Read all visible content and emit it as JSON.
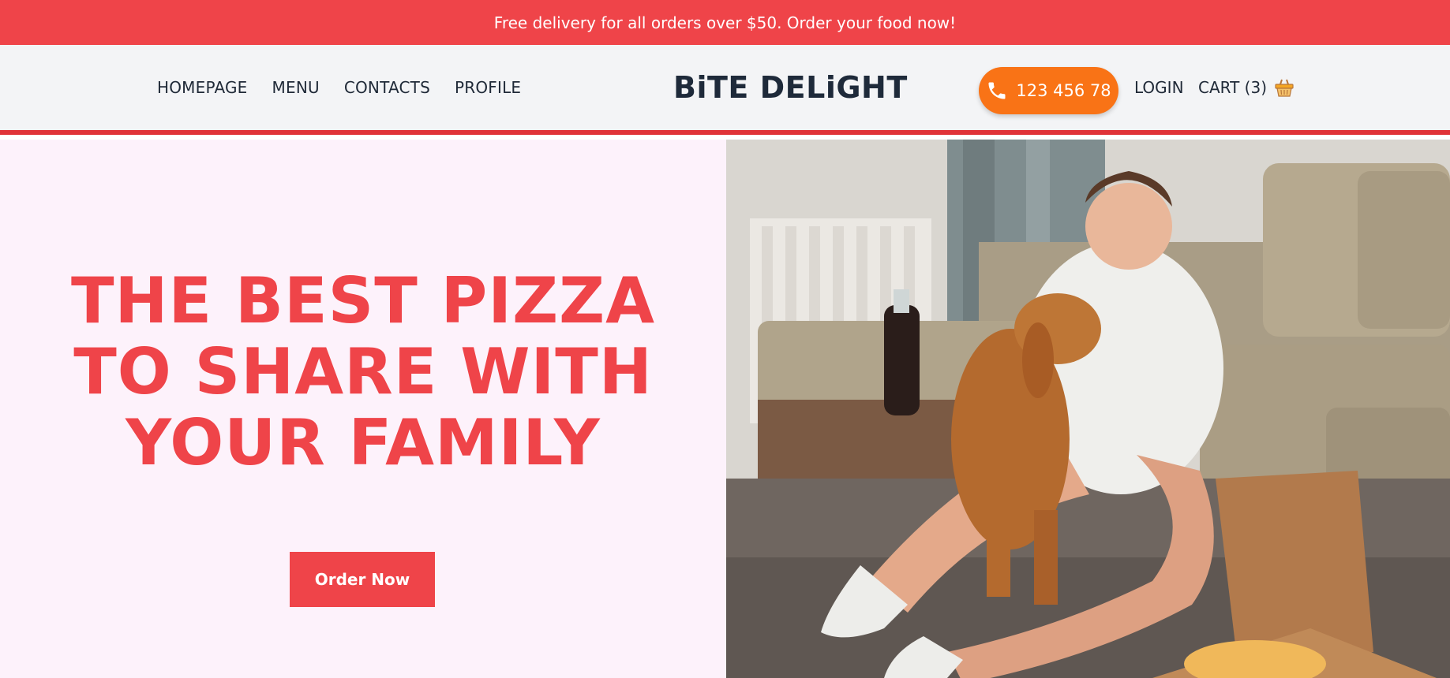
{
  "promo": {
    "text": "Free delivery for all orders over $50. Order your food now!"
  },
  "nav": {
    "items": [
      "HOMEPAGE",
      "MENU",
      "CONTACTS",
      "PROFILE"
    ]
  },
  "brand": {
    "name": "BiTE DELiGHT"
  },
  "actions": {
    "phone": "123 456 78",
    "login": "LOGIN",
    "cart": "CART (3)"
  },
  "hero": {
    "headline": [
      "THE BEST PIZZA",
      "TO SHARE WITH",
      "YOUR FAMILY"
    ],
    "cta": "Order Now",
    "image_alt": "woman sharing pizza with dog on couch"
  },
  "colors": {
    "accent": "#ef4449",
    "phone_button": "#f97316",
    "hero_background": "#fdf2fb",
    "header_background": "#f3f4f6"
  },
  "icons": {
    "phone": "phone-icon",
    "cart": "basket-icon"
  }
}
